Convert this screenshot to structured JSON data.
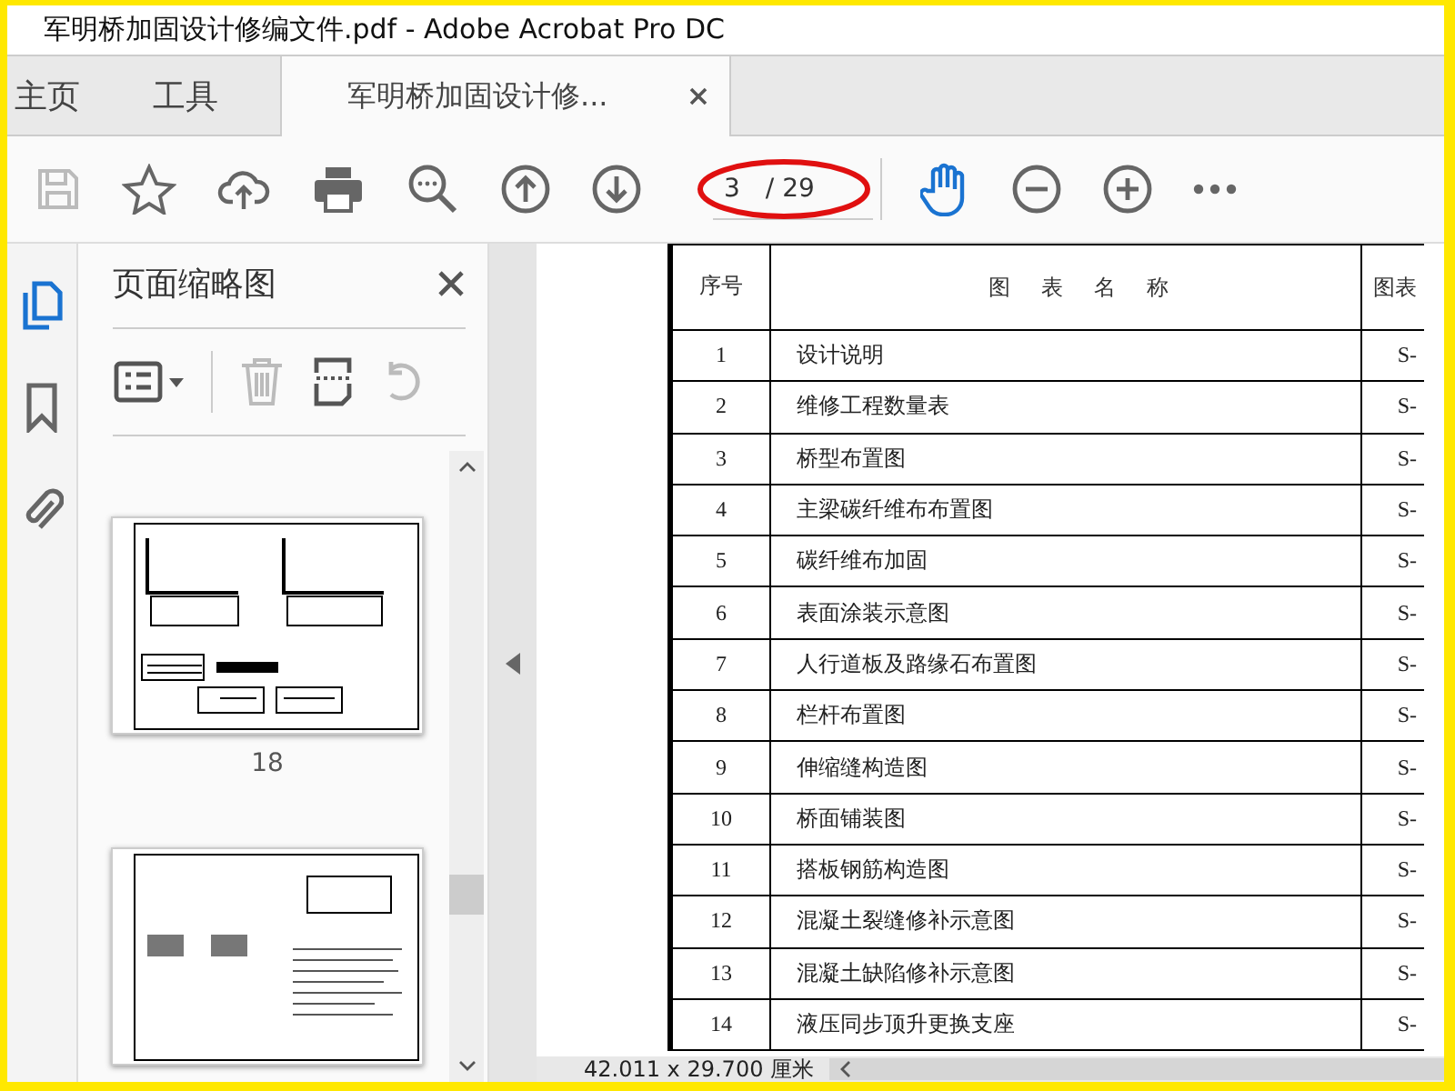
{
  "window": {
    "title": "军明桥加固设计修编文件.pdf - Adobe Acrobat Pro DC"
  },
  "tabs": [
    {
      "label": "主页",
      "selected": false,
      "closable": false
    },
    {
      "label": "工具",
      "selected": false,
      "closable": false
    },
    {
      "label": "军明桥加固设计修...",
      "selected": true,
      "closable": true
    }
  ],
  "toolbar": {
    "page_value": "3",
    "page_total": "/ 29"
  },
  "left_rail": [
    {
      "kind": "pages",
      "selected": true
    },
    {
      "kind": "bookmark",
      "selected": false
    },
    {
      "kind": "attachment",
      "selected": false
    }
  ],
  "thumbnail_panel": {
    "title": "页面缩略图",
    "thumbnails": [
      {
        "label": "18",
        "kind": "detail"
      },
      {
        "kind": "notes"
      }
    ]
  },
  "table": {
    "columns": [
      "序号",
      "图 表 名 称",
      "图表"
    ],
    "rows": [
      [
        "1",
        "设计说明",
        "S-"
      ],
      [
        "2",
        "维修工程数量表",
        "S-"
      ],
      [
        "3",
        "桥型布置图",
        "S-"
      ],
      [
        "4",
        "主梁碳纤维布布置图",
        "S-"
      ],
      [
        "5",
        "碳纤维布加固",
        "S-"
      ],
      [
        "6",
        "表面涂装示意图",
        "S-"
      ],
      [
        "7",
        "人行道板及路缘石布置图",
        "S-"
      ],
      [
        "8",
        "栏杆布置图",
        "S-"
      ],
      [
        "9",
        "伸缩缝构造图",
        "S-"
      ],
      [
        "10",
        "桥面铺装图",
        "S-"
      ],
      [
        "11",
        "搭板钢筋构造图",
        "S-"
      ],
      [
        "12",
        "混凝土裂缝修补示意图",
        "S-"
      ],
      [
        "13",
        "混凝土缺陷修补示意图",
        "S-"
      ],
      [
        "14",
        "液压同步顶升更换支座",
        "S-"
      ]
    ]
  },
  "status_bar": {
    "page_size": "42.011 x 29.700 厘米"
  }
}
